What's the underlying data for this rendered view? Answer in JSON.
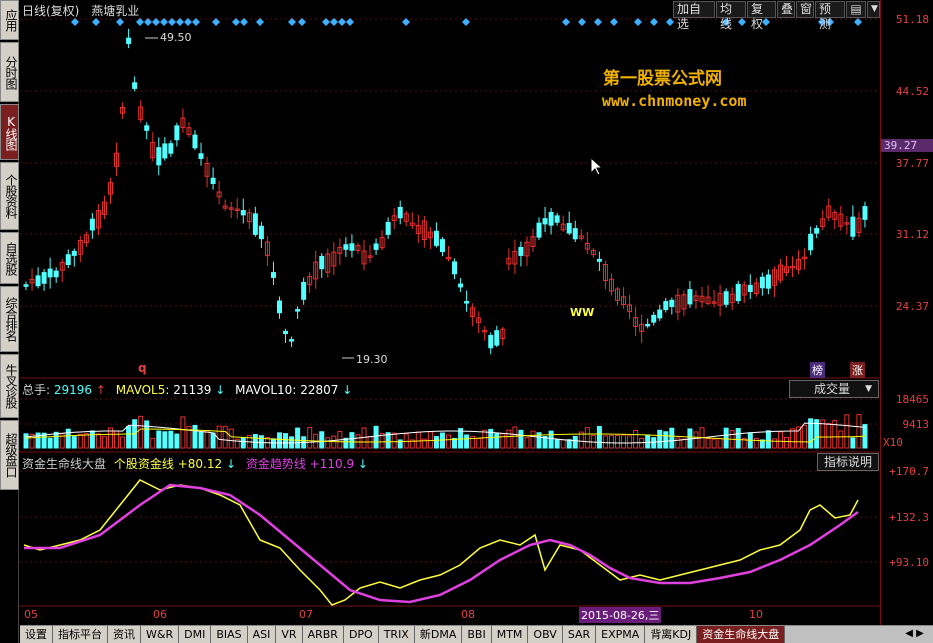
{
  "left_nav": [
    "应用",
    "分时图",
    "K线图",
    "个股资料",
    "自选股",
    "综合排名",
    "牛叉诊股",
    "超级盘口"
  ],
  "header": {
    "period_label": "日线(复权)",
    "stock_name": "燕塘乳业"
  },
  "toolbar": {
    "add_watchlist": "加自选",
    "ma_line": "均线",
    "adjust": "复权",
    "overlay": "叠",
    "window": "窗",
    "forecast": "预测",
    "dropdown_icon": "toolbar-menu-icon"
  },
  "watermark": {
    "line1": "第一股票公式网",
    "line2": "www.chnmoney.com"
  },
  "price_panel": {
    "high_marker": "49.50",
    "low_marker": "19.30",
    "q_marker": "q",
    "ww_marker": "WW",
    "badge_rank": "榜",
    "badge_rise": "涨",
    "right_ticks": [
      "51.18",
      "44.52",
      "39.27",
      "37.77",
      "31.12",
      "24.37"
    ],
    "current_price_tick": "39.27"
  },
  "volume_panel": {
    "total_label": "总手:",
    "total_value": "29196",
    "mavol5_label": "MAVOL5:",
    "mavol5_value": "21139",
    "mavol10_label": "MAVOL10:",
    "mavol10_value": "22807",
    "selector": "成交量",
    "right_ticks": [
      "18465",
      "9413"
    ],
    "multiplier": "X10"
  },
  "indicator_panel": {
    "name": "资金生命线大盘",
    "line1_label": "个股资金线",
    "line1_value": "+80.12",
    "line2_label": "资金趋势线",
    "line2_value": "+110.9",
    "help_button": "指标说明",
    "right_ticks": [
      "+170.7",
      "+132.3",
      "+93.10"
    ]
  },
  "x_axis": {
    "labels": [
      "05",
      "06",
      "07",
      "08",
      "10"
    ],
    "highlighted_date": "2015-08-26,三"
  },
  "tabs": [
    "设置",
    "指标平台",
    "资讯",
    "W&R",
    "DMI",
    "BIAS",
    "ASI",
    "VR",
    "ARBR",
    "DPO",
    "TRIX",
    "新DMA",
    "BBI",
    "MTM",
    "OBV",
    "SAR",
    "EXPMA",
    "背离KDJ",
    "资金生命线大盘"
  ],
  "active_tab": "资金生命线大盘",
  "colors": {
    "up": "#e83030",
    "down": "#54ffff",
    "axis": "#7a1010",
    "ma5": "#ffffff",
    "ma10": "#ffff00",
    "fund_line": "#ffff40",
    "trend_line": "#e040e0",
    "marker": "#3fb0ff"
  }
}
